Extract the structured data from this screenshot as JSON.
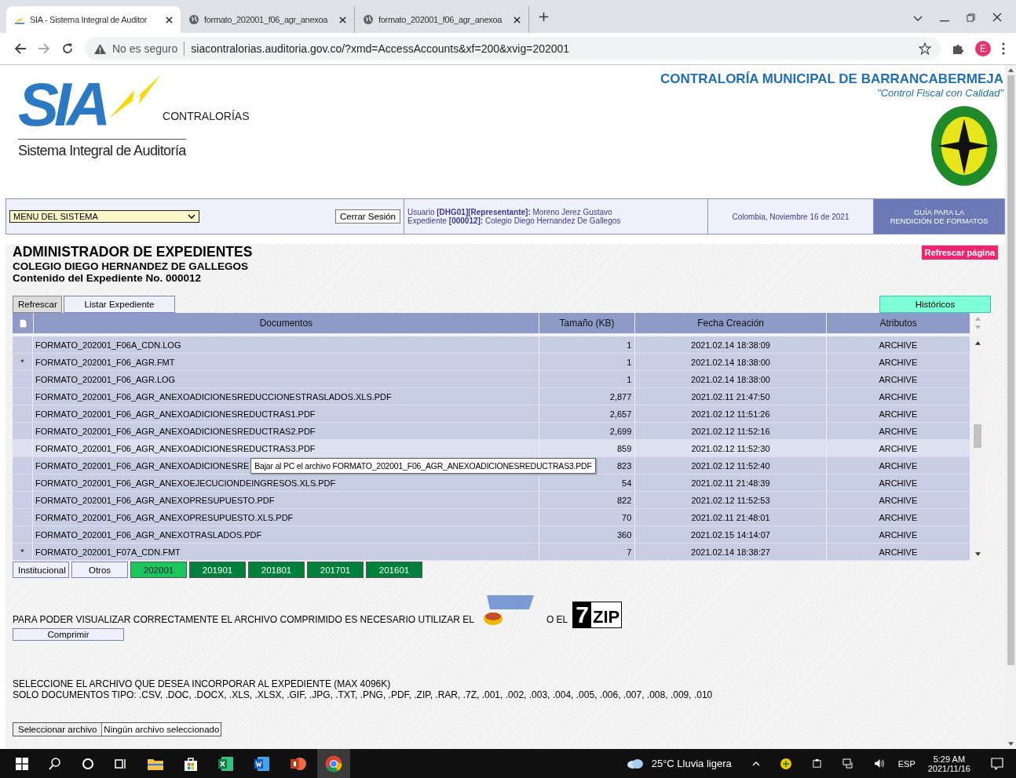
{
  "browser": {
    "tabs": [
      {
        "title": "SIA - Sistema Integral de Auditor",
        "selected": true
      },
      {
        "title": "formato_202001_f06_agr_anexoa",
        "selected": false
      },
      {
        "title": "formato_202001_f06_agr_anexoa",
        "selected": false
      }
    ],
    "security": "No es seguro",
    "url": "siacontralorias.auditoria.gov.co/?xmd=AccessAccounts&xf=200&xvig=202001",
    "profile_initial": "E"
  },
  "header": {
    "logo_text": "SIA",
    "logo_sub": "CONTRALORÍAS",
    "logo_caption": "Sistema Integral de Auditoría",
    "entity": "CONTRALORÍA MUNICIPAL DE BARRANCABERMEJA",
    "motto": "\"Control Fiscal con Calidad\""
  },
  "toolbar": {
    "menu": "MENU DEL SISTEMA",
    "logout": "Cerrar Sesión",
    "user_line": "Usuario **[DHG01][Representante]:** Moreno Jerez Gustavo",
    "file_line": "Expediente **[000012]:** Colegio Diego Hernandez De Gallegos",
    "date": "Colombia, Noviembre 16 de 2021",
    "guide": [
      "GUÍA PARA LA",
      "RENDICIÓN DE FORMATOS"
    ],
    "refresh_page": "Refrescar página"
  },
  "titles": [
    "ADMINISTRADOR DE EXPEDIENTES",
    "COLEGIO DIEGO HERNANDEZ DE GALLEGOS",
    "Contenido del Expediente No. 000012"
  ],
  "actions": [
    "Refrescar",
    "Listar Expediente"
  ],
  "history": "Históricos",
  "table": {
    "columns": [
      "Documentos",
      "Tamaño (KB)",
      "Fecha Creación",
      "Atributos"
    ],
    "rows": [
      {
        "name": "FORMATO_202001_F06A_CDN.LOG",
        "size": "1",
        "date": "2021.02.14 18:38:09",
        "attr": "ARCHIVE",
        "highlighted": false
      },
      {
        "marker": "*",
        "name": "FORMATO_202001_F06_AGR.FMT",
        "size": "1",
        "date": "2021.02.14 18:38:00",
        "attr": "ARCHIVE",
        "highlighted": false
      },
      {
        "name": "FORMATO_202001_F06_AGR.LOG",
        "size": "1",
        "date": "2021.02.14 18:38:00",
        "attr": "ARCHIVE",
        "highlighted": false
      },
      {
        "name": "FORMATO_202001_F06_AGR_ANEXOADICIONESREDUCCIONESTRASLADOS.XLS.PDF",
        "size": "2,877",
        "date": "2021.02.11 21:47:50",
        "attr": "ARCHIVE",
        "highlighted": false
      },
      {
        "name": "FORMATO_202001_F06_AGR_ANEXOADICIONESREDUCTRAS1.PDF",
        "size": "2,657",
        "date": "2021.02.12 11:51:26",
        "attr": "ARCHIVE",
        "highlighted": false
      },
      {
        "name": "FORMATO_202001_F06_AGR_ANEXOADICIONESREDUCTRAS2.PDF",
        "size": "2,699",
        "date": "2021.02.12 11:52:16",
        "attr": "ARCHIVE",
        "highlighted": false
      },
      {
        "name": "FORMATO_202001_F06_AGR_ANEXOADICIONESREDUCTRAS3.PDF",
        "size": "859",
        "date": "2021.02.12 11:52:30",
        "attr": "ARCHIVE",
        "highlighted": true
      },
      {
        "name": "FORMATO_202001_F06_AGR_ANEXOADICIONESRE",
        "size": "823",
        "date": "2021.02.12 11:52:40",
        "attr": "ARCHIVE",
        "highlighted": false,
        "tooltip": "Bajar al PC el archivo FORMATO_202001_F06_AGR_ANEXOADICIONESREDUCTRAS3.PDF"
      },
      {
        "name": "FORMATO_202001_F06_AGR_ANEXOEJECUCIONDEINGRESOS.XLS.PDF",
        "size": "54",
        "date": "2021.02.11 21:48:39",
        "attr": "ARCHIVE",
        "highlighted": false
      },
      {
        "name": "FORMATO_202001_F06_AGR_ANEXOPRESUPUESTO.PDF",
        "size": "822",
        "date": "2021.02.12 11:52:53",
        "attr": "ARCHIVE",
        "highlighted": false
      },
      {
        "name": "FORMATO_202001_F06_AGR_ANEXOPRESUPUESTO.XLS.PDF",
        "size": "70",
        "date": "2021.02.11 21:48:01",
        "attr": "ARCHIVE",
        "highlighted": false
      },
      {
        "name": "FORMATO_202001_F06_AGR_ANEXOTRASLADOS.PDF",
        "size": "360",
        "date": "2021.02.15 14:14:07",
        "attr": "ARCHIVE",
        "highlighted": false
      },
      {
        "marker": "*",
        "name": "FORMATO_202001_F07A_CDN.FMT",
        "size": "7",
        "date": "2021.02.14 18:38:27",
        "attr": "ARCHIVE",
        "highlighted": false
      }
    ]
  },
  "periods": [
    {
      "label": "Institucional",
      "kind": "category",
      "selected": false
    },
    {
      "label": "Otros",
      "kind": "category",
      "selected": false
    },
    {
      "label": "202001",
      "kind": "year",
      "selected": true
    },
    {
      "label": "201901",
      "kind": "year",
      "selected": false
    },
    {
      "label": "201801",
      "kind": "year",
      "selected": false
    },
    {
      "label": "201701",
      "kind": "year",
      "selected": false
    },
    {
      "label": "201601",
      "kind": "year",
      "selected": false
    }
  ],
  "compress": {
    "note": "PARA PODER VISUALIZAR CORRECTAMENTE EL ARCHIVO COMPRIMIDO ES NECESARIO UTILIZAR EL",
    "or": "O EL",
    "zip_logo": [
      "7",
      "ZIP"
    ],
    "button": "Comprimir"
  },
  "upload": {
    "lines": [
      "SELECCIONE EL ARCHIVO QUE DESEA INCORPORAR AL EXPEDIENTE (MAX 4096K)",
      "SOLO DOCUMENTOS TIPO: .CSV, .DOC, .DOCX, .XLS, .XLSX, .GIF, .JPG, .TXT, .PNG, .PDF, .ZIP, .RAR, .7Z, .001, .002, .003, .004, .005, .006, .007, .008, .009, .010"
    ],
    "button": "Seleccionar archivo",
    "status": "Ningún archivo seleccionado"
  },
  "taskbar": {
    "weather": "25°C  Lluvia ligera",
    "lang": "ESP",
    "time": "5:29 AM",
    "date": "2021/11/16"
  }
}
